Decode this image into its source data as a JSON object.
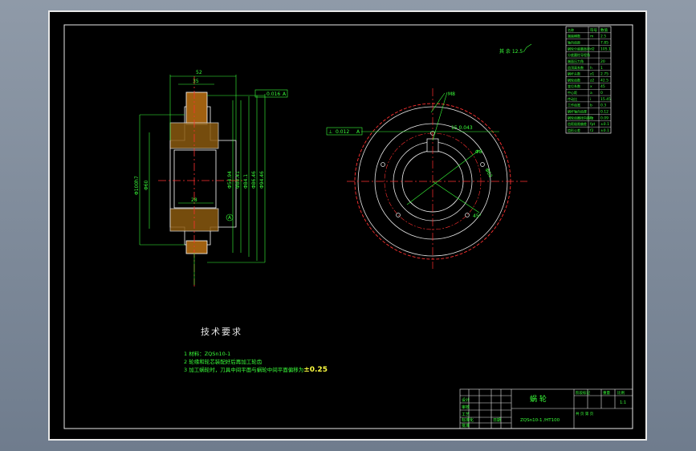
{
  "colors": {
    "background": "#000000",
    "frame": "#e8e8e8",
    "dimension": "#3aff3a",
    "centerline": "#ff3030",
    "accent": "#ffff40",
    "outline": "#ffffff"
  },
  "section_view": {
    "dim_top_52": "52",
    "dim_top_35": "35",
    "dim_width_inner": "28",
    "tol_frame": "0.016",
    "tol_frame_datum": "A",
    "dim_left_outer": "Φ100h7",
    "dim_left_inner": "Φ60",
    "diameters": [
      "Φ54.94",
      "Φ80.41",
      "Φ84.1",
      "Φ86.46",
      "Φ94.46"
    ],
    "datum": "A"
  },
  "front_view": {
    "tol_frame_symbol": "⊥",
    "tol_frame_value": "0.012",
    "tol_frame_datum": "A",
    "dim_keyway": "15 0.043",
    "dim_bore_hole": "Φ8",
    "dim_hole_pattern": "M8",
    "dim_hole_pcd": "Φ62",
    "dim_bore_angle": "45°"
  },
  "roughness_note": "其 余 12.5",
  "param_table": {
    "headers": [
      "名称",
      "符号",
      "数值"
    ],
    "rows": [
      [
        "端面模数",
        "m",
        "2.5"
      ],
      [
        "轴向齿距",
        "",
        "7.85"
      ],
      [
        "蜗轮分度圆直径",
        "d2",
        "105.1"
      ],
      [
        "分度圆柱导程角",
        "",
        ""
      ],
      [
        "端面压力角",
        "",
        "20"
      ],
      [
        "齿顶高系数",
        "h",
        "1"
      ],
      [
        "蜗杆头数",
        "z1",
        "2.75"
      ],
      [
        "蜗轮齿数",
        "z2",
        "42.5"
      ],
      [
        "变位系数",
        "x",
        "45"
      ],
      [
        "中心距",
        "a",
        "0"
      ],
      [
        "传动比",
        "i",
        "15.45"
      ],
      [
        "工作齿宽",
        "b",
        "0.3"
      ],
      [
        "蜗杆轴向齿厚",
        "",
        "0.12"
      ],
      [
        "蜗轮齿圈径向跳动",
        "Fr",
        "0.09"
      ],
      [
        "齿距极限偏差",
        "fpt",
        "±0.1"
      ],
      [
        "齿形公差",
        "f2",
        "±0.1"
      ]
    ]
  },
  "tech_requirements": {
    "title": "技术要求",
    "item1": "1 材料：ZQSn10-1",
    "item2": "2 轮缘和轮芯装配好后再加工轮齿",
    "item3": "3 加工蜗轮时，刀具中间平面与蜗轮中间平面偏移为",
    "item3_tolerance": "±0.25"
  },
  "title_block": {
    "part_name": "蜗  轮",
    "material": "ZQSn10-1 /HT100",
    "scale": "1:1",
    "label_stage": "阶段标记",
    "label_weight": "重量",
    "label_scale": "比例",
    "label_page": "共 页 第 页",
    "label_designer": "设计",
    "label_checker": "审核",
    "label_process": "工艺",
    "label_approve": "批准",
    "label_standard": "标准化",
    "label_date": "日期"
  }
}
